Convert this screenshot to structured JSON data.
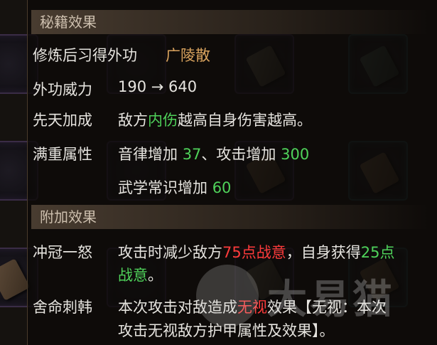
{
  "section_secret": {
    "title": "秘籍效果"
  },
  "rows_secret": [
    {
      "label": "修炼后习得外功",
      "value": "广陵散"
    },
    {
      "label": "外功威力",
      "value": "190 → 640"
    },
    {
      "label": "先天加成",
      "value_parts": [
        "敌方",
        "内伤",
        "越高自身伤害越高。"
      ]
    },
    {
      "label": "满重属性",
      "line1": [
        "音律增加 ",
        "37",
        "、攻击增加 ",
        "300"
      ],
      "line2": [
        "武学常识增加 ",
        "60"
      ]
    }
  ],
  "section_extra": {
    "title": "附加效果"
  },
  "rows_extra": [
    {
      "label": "冲冠一怒",
      "line1": [
        "攻击时减少敌方",
        "75点战意",
        "，自身获得",
        "25点"
      ],
      "line2": [
        "战意",
        "。"
      ]
    },
    {
      "label": "舍命刺韩",
      "line1": [
        "本次攻击对敌造成",
        "无视",
        "效果【无视：本次"
      ],
      "line2": [
        "攻击无视敌方护甲属性及效果】。"
      ]
    }
  ],
  "watermark": {
    "text": "大易猫"
  },
  "colors": {
    "gold": "#d9a35e",
    "green": "#4fd25a",
    "red": "#ff3b3b",
    "text": "#e6e4df"
  }
}
